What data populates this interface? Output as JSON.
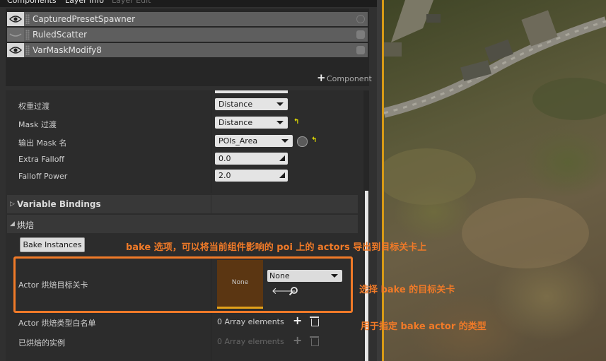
{
  "tabs": [
    "Components",
    "Layer Info",
    "Layer Edit"
  ],
  "components": [
    {
      "name": "CapturedPresetSpawner",
      "visible": true
    },
    {
      "name": "RuledScatter",
      "visible": false
    },
    {
      "name": "VarMaskModify8",
      "visible": true
    }
  ],
  "add_component_label": "Component",
  "properties": {
    "weight_transition": {
      "label": "权重过渡",
      "value": "Distance"
    },
    "mask_transition": {
      "label": "Mask 过渡",
      "value": "Distance"
    },
    "output_mask_name": {
      "label": "输出 Mask 名",
      "value": "POIs_Area"
    },
    "extra_falloff": {
      "label": "Extra Falloff",
      "value": "0.0"
    },
    "falloff_power": {
      "label": "Falloff Power",
      "value": "2.0"
    }
  },
  "sections": {
    "variable_bindings": "Variable Bindings",
    "bake": "烘焙"
  },
  "bake_instances_label": "Bake Instances",
  "bake_target_level": {
    "label": "Actor 烘焙目标关卡",
    "thumbnail_text": "None",
    "value": "None"
  },
  "bake_type_whitelist": {
    "label": "Actor 烘焙类型白名单",
    "value": "0 Array elements"
  },
  "baked_instances": {
    "label": "已烘焙的实例",
    "value": "0 Array elements"
  },
  "annotations": {
    "bake_option": "bake 选项，可以将当前组件影响的 poi 上的 actors 导出到目标关卡上",
    "select_target": "选择 bake 的目标关卡",
    "specify_type": "用于指定 bake actor 的类型"
  },
  "colors": {
    "accent_orange": "#f07a28",
    "viewport_border": "#d79a16",
    "reset_arrow": "#e6e000"
  }
}
